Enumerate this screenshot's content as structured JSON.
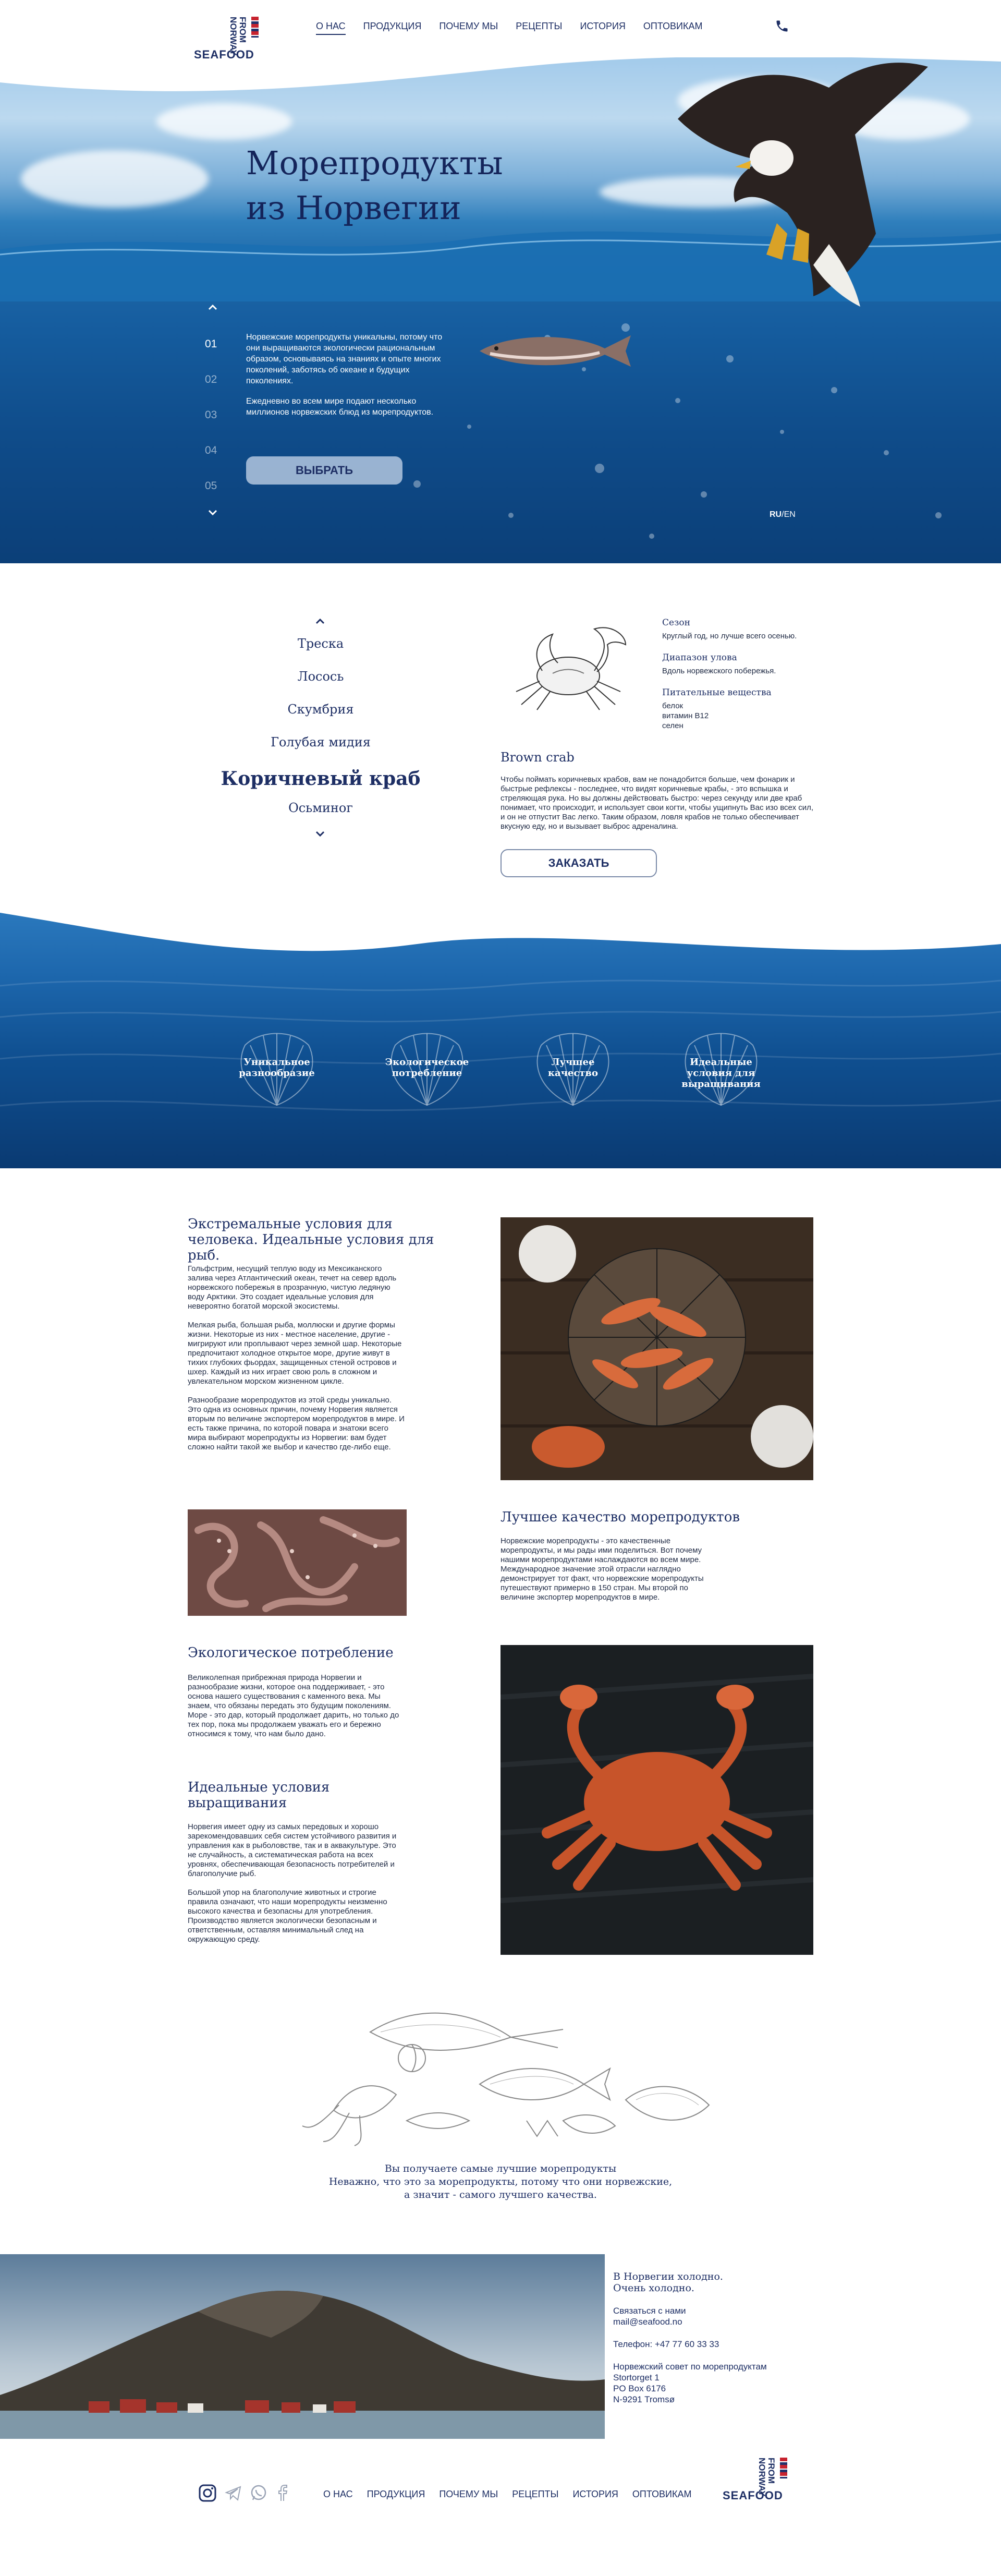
{
  "brand": {
    "logo_main": "SEAFOOD",
    "logo_vertical": "FROM NORWAY"
  },
  "nav": {
    "items": [
      {
        "label": "О НАС"
      },
      {
        "label": "ПРОДУКЦИЯ"
      },
      {
        "label": "ПОЧЕМУ МЫ"
      },
      {
        "label": "РЕЦЕПТЫ"
      },
      {
        "label": "ИСТОРИЯ"
      },
      {
        "label": "ОПТОВИКАМ"
      }
    ],
    "active": "О НАС"
  },
  "hero": {
    "title_line1": "Морепродукты",
    "title_line2": "из Норвегии",
    "paragraph1": "Норвежские морепродукты уникальны, потому что они выращиваются экологически рациональным образом, основываясь на знаниях и опыте многих поколений, заботясь об океане и будущих поколениях.",
    "paragraph2": "Ежедневно во всем мире подают несколько миллионов норвежских блюд из морепродуктов.",
    "slides": [
      "01",
      "02",
      "03",
      "04",
      "05"
    ],
    "active_slide": "01",
    "button": "ВЫБРАТЬ",
    "lang_ru": "RU",
    "lang_sep": "/",
    "lang_en": "EN"
  },
  "products": {
    "list": [
      "Треска",
      "Лосось",
      "Скумбрия",
      "Голубая мидия",
      "Коричневый краб",
      "Осьминог"
    ],
    "selected": "Коричневый краб",
    "season_label": "Сезон",
    "season_value": "Круглый год, но лучше всего осенью.",
    "range_label": "Диапазон улова",
    "range_value": "Вдоль норвежского побережья.",
    "nutrients_label": "Питательные вещества",
    "nutrients": [
      "белок",
      "витамин B12",
      "селен"
    ],
    "name": "Brown crab",
    "description": "Чтобы поймать коричневых крабов, вам не понадобится больше, чем фонарик и быстрые рефлексы - последнее, что видят коричневые крабы, - это вспышка и стреляющая рука. Но вы должны действовать быстро: через секунду или две краб понимает, что происходит, и использует свои когти, чтобы ущипнуть Вас изо всех сил, и он не отпустит Вас легко. Таким образом, ловля крабов не только обеспечивает вкусную еду, но и вызывает выброс адреналина.",
    "button": "ЗАКАЗАТЬ"
  },
  "features": [
    {
      "label": "Уникальное разнообразие"
    },
    {
      "label": "Экологическое потребление"
    },
    {
      "label": "Лучшее качество"
    },
    {
      "label": "Идеальные условия для выращивания"
    }
  ],
  "articles": {
    "extreme": {
      "title": "Экстремальные условия для человека. Идеальные условия для рыб.",
      "p1": "Гольфстрим, несущий теплую воду из Мексиканского залива через Атлантический океан, течет на север вдоль норвежского побережья в прозрачную, чистую ледяную воду Арктики. Это создает идеальные условия для невероятно богатой морской экосистемы.",
      "p2": "Мелкая рыба, большая рыба, моллюски и другие формы жизни. Некоторые из них - местное население, другие - мигрируют или проплывают через земной шар. Некоторые предпочитают холодное открытое море, другие живут в тихих глубоких фьордах, защищенных стеной островов и шхер. Каждый из них играет свою роль в сложном и увлекательном морском жизненном цикле.",
      "p3": "Разнообразие морепродуктов из этой среды уникально. Это одна из основных причин, почему Норвегия является вторым по величине экспортером морепродуктов в мире. И есть также причина, по которой повара и знатоки всего мира выбирают морепродукты из Норвегии: вам будет сложно найти такой же выбор и качество где-либо еще."
    },
    "quality": {
      "title": "Лучшее качество морепродуктов",
      "p1": "Норвежские морепродукты - это качественные морепродукты, и мы рады ими поделиться. Вот почему нашими морепродуктами наслаждаются во всем мире. Международное значение этой отрасли наглядно демонстрирует тот факт, что норвежские морепродукты путешествуют примерно в 150 стран. Мы второй по величине экспортер морепродуктов в мире."
    },
    "eco": {
      "title": "Экологическое потребление",
      "p1": "Великолепная прибрежная природа Норвегии и разнообразие жизни, которое она поддерживает, - это основа нашего существования с каменного века. Мы знаем, что обязаны передать это будущим поколениям. Море - это дар, который продолжает дарить, но только до тех пор, пока мы продолжаем уважать его и бережно относимся к тому, что нам было дано."
    },
    "ideal": {
      "title": "Идеальные условия выращивания",
      "p1": "Норвегия имеет одну из самых передовых и хорошо зарекомендовавших себя систем устойчивого развития и управления как в рыболовстве, так и в аквакультуре. Это не случайность, а систематическая работа на всех уровнях, обеспечивающая безопасность потребителей и благополучие рыб.",
      "p2": "Большой упор на благополучие животных и строгие правила означают, что наши морепродукты неизменно высокого качества и безопасны для употребления. Производство является экологически безопасным и ответственным, оставляя минимальный след на окружающую среду."
    }
  },
  "closing": {
    "line1": "Вы получаете самые лучшие морепродукты",
    "line2": "Неважно, что это за морепродукты, потому что они норвежские,",
    "line3": "а значит - самого лучшего качества."
  },
  "contact": {
    "heading_line1": "В Норвегии холодно.",
    "heading_line2": "Очень холодно.",
    "contact_label": "Связаться с нами",
    "email": "mail@seafood.no",
    "phone": "Телефон: +47 77 60 33 33",
    "org": "Норвежский совет по морепродуктам",
    "street": "Stortorget 1",
    "box": "PO Box 6176",
    "city": "N-9291 Tromsø"
  },
  "colors": {
    "navy": "#1d2e64",
    "ocean": "#155c9e",
    "flag_red": "#c7232f"
  },
  "icons": [
    "phone-icon",
    "chevron-up-icon",
    "chevron-down-icon",
    "instagram-icon",
    "telegram-icon",
    "whatsapp-icon",
    "facebook-icon"
  ]
}
